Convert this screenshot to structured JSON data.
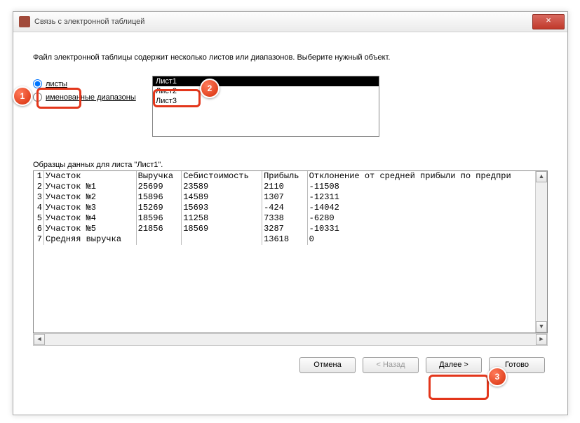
{
  "window": {
    "title": "Связь с электронной таблицей",
    "close_icon": "×"
  },
  "instruction": "Файл электронной таблицы содержит несколько листов или диапазонов.  Выберите нужный объект.",
  "radios": {
    "sheets": "листы",
    "ranges": "именованные диапазоны"
  },
  "list": {
    "items": [
      "Лист1",
      "Лист2",
      "Лист3"
    ],
    "selected": "Лист1"
  },
  "preview": {
    "label": "Образцы данных для листа \"Лист1\".",
    "columns": [
      "",
      "Участок",
      "Выручка",
      "Себистоимость",
      "Прибыль",
      "Отклонение от средней прибыли по предпри"
    ],
    "rows": [
      [
        "1",
        "Участок",
        "Выручка",
        "Себистоимость",
        "Прибыль",
        "Отклонение от средней прибыли по предпри"
      ],
      [
        "2",
        "Участок №1",
        "25699",
        "23589",
        "2110",
        "-11508"
      ],
      [
        "3",
        "Участок №2",
        "15896",
        "14589",
        "1307",
        "-12311"
      ],
      [
        "4",
        "Участок №3",
        "15269",
        "15693",
        "-424",
        "-14042"
      ],
      [
        "5",
        "Участок №4",
        "18596",
        "11258",
        "7338",
        "-6280"
      ],
      [
        "6",
        "Участок №5",
        "21856",
        "18569",
        "3287",
        "-10331"
      ],
      [
        "7",
        "Средняя выручка",
        "",
        "",
        "13618",
        "0"
      ]
    ]
  },
  "buttons": {
    "cancel": "Отмена",
    "back": "< Назад",
    "next": "Далее >",
    "finish": "Готово"
  },
  "badges": {
    "b1": "1",
    "b2": "2",
    "b3": "3"
  }
}
